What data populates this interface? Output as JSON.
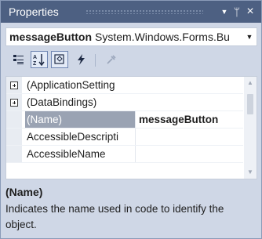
{
  "titlebar": {
    "title": "Properties",
    "dropdown_icon": "triangle-down",
    "pin_icon": "pin",
    "close_icon": "close"
  },
  "object_selector": {
    "name": "messageButton",
    "type": "System.Windows.Forms.Bu"
  },
  "toolbar": {
    "items": [
      "categorized-icon",
      "alphabetical-icon",
      "properties-icon",
      "events-icon",
      "property-pages-icon"
    ]
  },
  "grid": {
    "rows": [
      {
        "name": "(ApplicationSetting",
        "value": "",
        "category": true
      },
      {
        "name": "(DataBindings)",
        "value": "",
        "category": true
      },
      {
        "name": "(Name)",
        "value": "messageButton",
        "selected": true
      },
      {
        "name": "AccessibleDescripti",
        "value": ""
      },
      {
        "name": "AccessibleName",
        "value": ""
      }
    ]
  },
  "description": {
    "title": "(Name)",
    "text": "Indicates the name used in code to identify the object."
  },
  "colors": {
    "titlebar_bg": "#4d6082",
    "panel_bg": "#cfd7e6",
    "selected_name_bg": "#9aa3b3"
  }
}
